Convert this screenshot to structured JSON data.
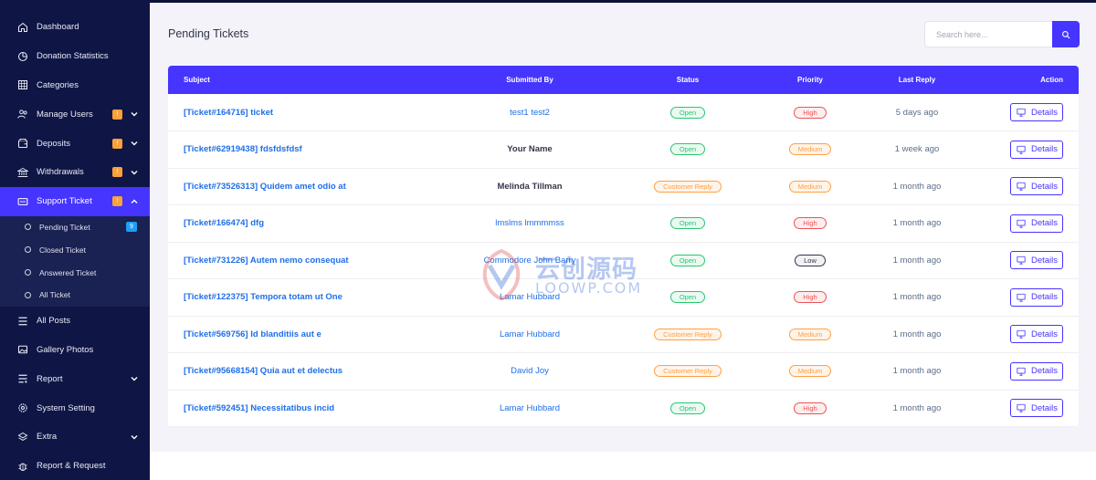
{
  "sidebar": {
    "items": [
      {
        "label": "Dashboard",
        "icon": "home-icon"
      },
      {
        "label": "Donation Statistics",
        "icon": "chart-icon"
      },
      {
        "label": "Categories",
        "icon": "grid-icon"
      },
      {
        "label": "Manage Users",
        "icon": "users-icon",
        "badge": "!",
        "chevron": "down"
      },
      {
        "label": "Deposits",
        "icon": "wallet-icon",
        "badge": "!",
        "chevron": "down"
      },
      {
        "label": "Withdrawals",
        "icon": "bank-icon",
        "badge": "!",
        "chevron": "down"
      },
      {
        "label": "Support Ticket",
        "icon": "ticket-icon",
        "badge": "!",
        "chevron": "up",
        "active": true
      },
      {
        "label": "All Posts",
        "icon": "list-icon"
      },
      {
        "label": "Gallery Photos",
        "icon": "image-icon"
      },
      {
        "label": "Report",
        "icon": "report-icon",
        "chevron": "down"
      },
      {
        "label": "System Setting",
        "icon": "gear-icon"
      },
      {
        "label": "Extra",
        "icon": "layers-icon",
        "chevron": "down"
      },
      {
        "label": "Report & Request",
        "icon": "bug-icon"
      }
    ],
    "support_sub": [
      {
        "label": "Pending Ticket",
        "count": "9",
        "active": true
      },
      {
        "label": "Closed Ticket"
      },
      {
        "label": "Answered Ticket"
      },
      {
        "label": "All Ticket"
      }
    ]
  },
  "header": {
    "title": "Pending Tickets",
    "search_placeholder": "Search here..."
  },
  "table": {
    "columns": [
      "Subject",
      "Submitted By",
      "Status",
      "Priority",
      "Last Reply",
      "Action"
    ],
    "rows": [
      {
        "subject": "[Ticket#164716] ticket",
        "submitted_by": "test1 test2",
        "submitter_linked": true,
        "status": "Open",
        "priority": "High",
        "last_reply": "5 days ago",
        "action": "Details"
      },
      {
        "subject": "[Ticket#62919438] fdsfdsfdsf",
        "submitted_by": "Your Name",
        "submitter_linked": false,
        "status": "Open",
        "priority": "Medium",
        "last_reply": "1 week ago",
        "action": "Details"
      },
      {
        "subject": "[Ticket#73526313] Quidem amet odio at",
        "submitted_by": "Melinda Tillman",
        "submitter_linked": false,
        "status": "Customer Reply",
        "priority": "Medium",
        "last_reply": "1 month ago",
        "action": "Details"
      },
      {
        "subject": "[Ticket#166474] dfg",
        "submitted_by": "lmslms lmmmmss",
        "submitter_linked": true,
        "status": "Open",
        "priority": "High",
        "last_reply": "1 month ago",
        "action": "Details"
      },
      {
        "subject": "[Ticket#731226] Autem nemo consequat",
        "submitted_by": "Commodore John Barry",
        "submitter_linked": true,
        "status": "Open",
        "priority": "Low",
        "last_reply": "1 month ago",
        "action": "Details"
      },
      {
        "subject": "[Ticket#122375] Tempora totam ut One",
        "submitted_by": "Lamar Hubbard",
        "submitter_linked": true,
        "status": "Open",
        "priority": "High",
        "last_reply": "1 month ago",
        "action": "Details"
      },
      {
        "subject": "[Ticket#569756] Id blanditiis aut e",
        "submitted_by": "Lamar Hubbard",
        "submitter_linked": true,
        "status": "Customer Reply",
        "priority": "Medium",
        "last_reply": "1 month ago",
        "action": "Details"
      },
      {
        "subject": "[Ticket#95668154] Quia aut et delectus",
        "submitted_by": "David Joy",
        "submitter_linked": true,
        "status": "Customer Reply",
        "priority": "Medium",
        "last_reply": "1 month ago",
        "action": "Details"
      },
      {
        "subject": "[Ticket#592451] Necessitatibus incid",
        "submitted_by": "Lamar Hubbard",
        "submitter_linked": true,
        "status": "Open",
        "priority": "High",
        "last_reply": "1 month ago",
        "action": "Details"
      }
    ]
  },
  "watermark": {
    "cn_text": "云创源码",
    "en_text": "LOOWP.COM"
  },
  "colors": {
    "accent": "#4634ff",
    "sidebar_bg": "#0f1645",
    "link": "#1e6fe8",
    "success": "#28c76f",
    "warning": "#ff9f43",
    "danger": "#ea5455"
  }
}
